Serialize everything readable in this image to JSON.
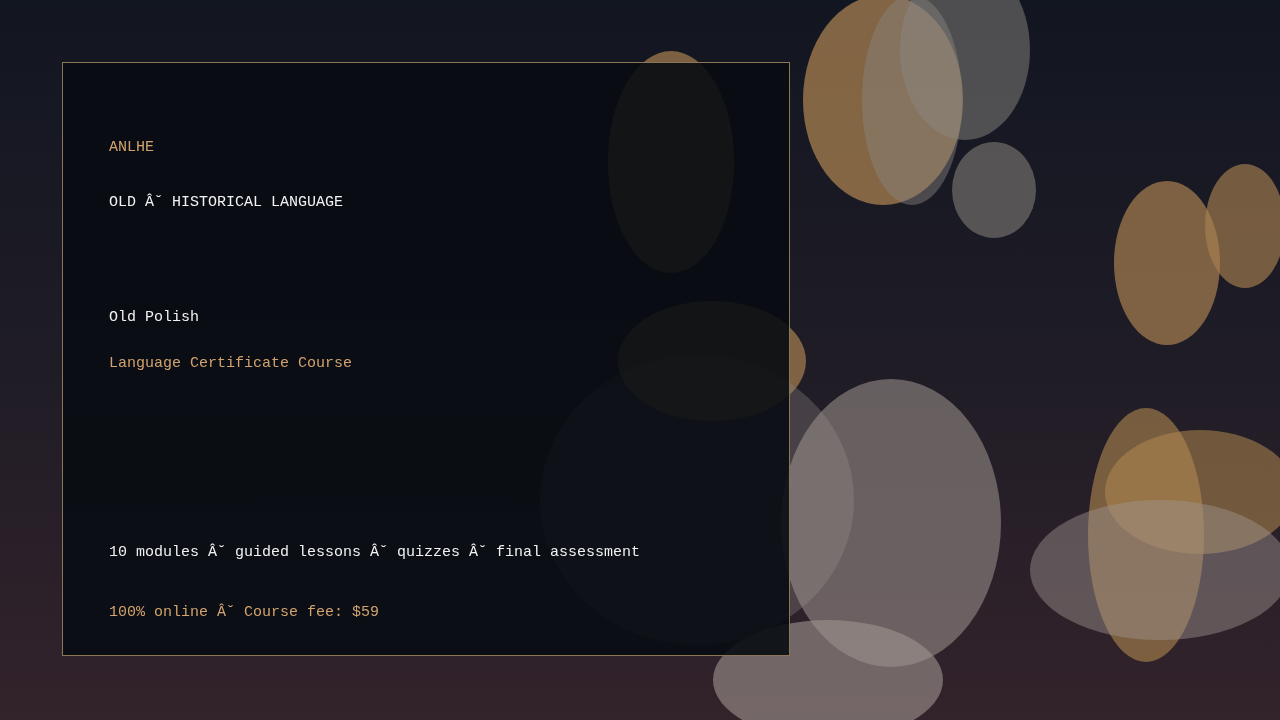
{
  "brand": "ANLHE",
  "tagline": "OLD Â˘ HISTORICAL LANGUAGE",
  "title": "Old Polish",
  "subtitle": "Language Certificate Course",
  "features": "10 modules Â˘ guided lessons Â˘ quizzes Â˘ final assessment",
  "price_line": "100% online Â˘ Course fee: $59"
}
